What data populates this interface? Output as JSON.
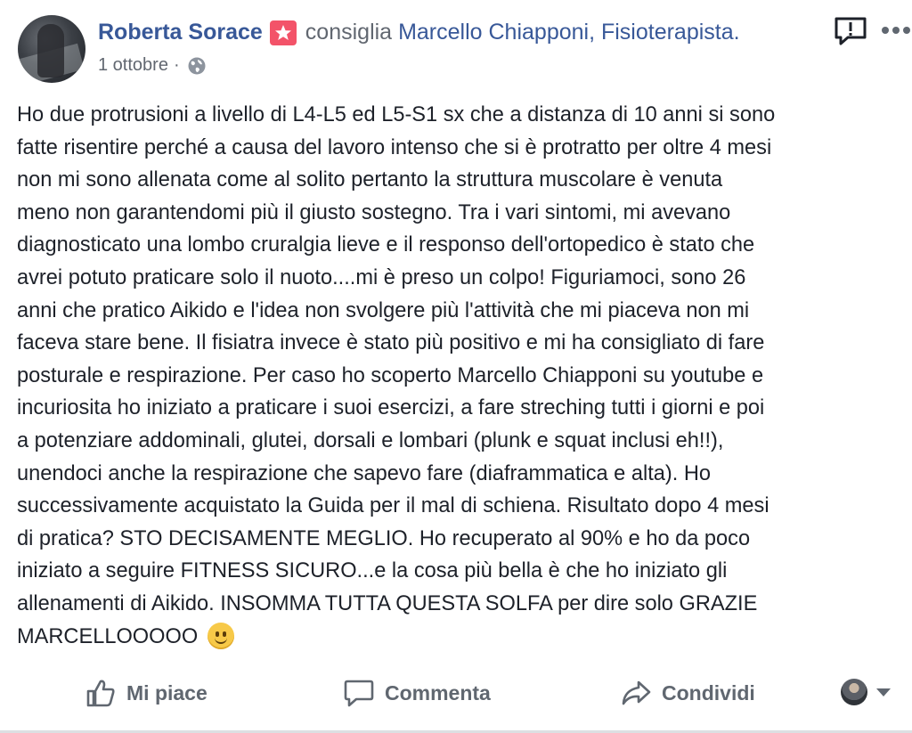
{
  "header": {
    "author": "Roberta Sorace",
    "verb": "consiglia",
    "page_name": "Marcello Chiapponi, Fisioterapista.",
    "date": "1 ottobre",
    "separator": "·"
  },
  "post": {
    "lines": [
      "Ho due protrusioni a livello di L4-L5 ed L5-S1 sx che a distanza di 10 anni si sono",
      "fatte risentire perché a causa del lavoro intenso che si è protratto per oltre 4 mesi",
      "non mi sono allenata come al solito pertanto la struttura muscolare è venuta",
      "meno non garantendomi più il giusto sostegno. Tra i vari sintomi, mi avevano",
      "diagnosticato una lombo cruralgia lieve e il responso dell'ortopedico è stato che",
      "avrei potuto praticare solo il nuoto....mi è preso un colpo! Figuriamoci, sono 26",
      "anni che pratico Aikido e l'idea non svolgere più l'attività che mi piaceva non mi",
      "faceva stare bene. Il fisiatra invece è stato più positivo e mi ha consigliato di fare",
      "posturale e respirazione. Per caso ho scoperto Marcello Chiapponi su youtube e",
      "incuriosita ho iniziato a praticare i suoi esercizi, a fare streching tutti i giorni e poi",
      "a potenziare addominali, glutei, dorsali e lombari (plunk e squat inclusi eh!!),",
      "unendoci anche la respirazione che sapevo fare (diaframmatica e alta). Ho",
      "successivamente acquistato la Guida per il mal di schiena. Risultato dopo 4 mesi",
      "di pratica? STO DECISAMENTE MEGLIO. Ho recuperato al 90% e ho da poco",
      "iniziato a seguire FITNESS SICURO...e la cosa più bella è che ho iniziato gli",
      "allenamenti di Aikido. INSOMMA TUTTA QUESTA SOLFA per dire solo GRAZIE",
      "MARCELLOOOOO"
    ]
  },
  "actions": {
    "like": "Mi piace",
    "comment": "Commenta",
    "share": "Condividi"
  },
  "colors": {
    "link": "#385898",
    "badge": "#f35369",
    "muted": "#616770",
    "text": "#1d2129"
  },
  "icons": [
    "star-badge-icon",
    "globe-icon",
    "report-icon",
    "more-icon",
    "like-icon",
    "comment-icon",
    "share-icon",
    "smile-emoji-icon"
  ]
}
